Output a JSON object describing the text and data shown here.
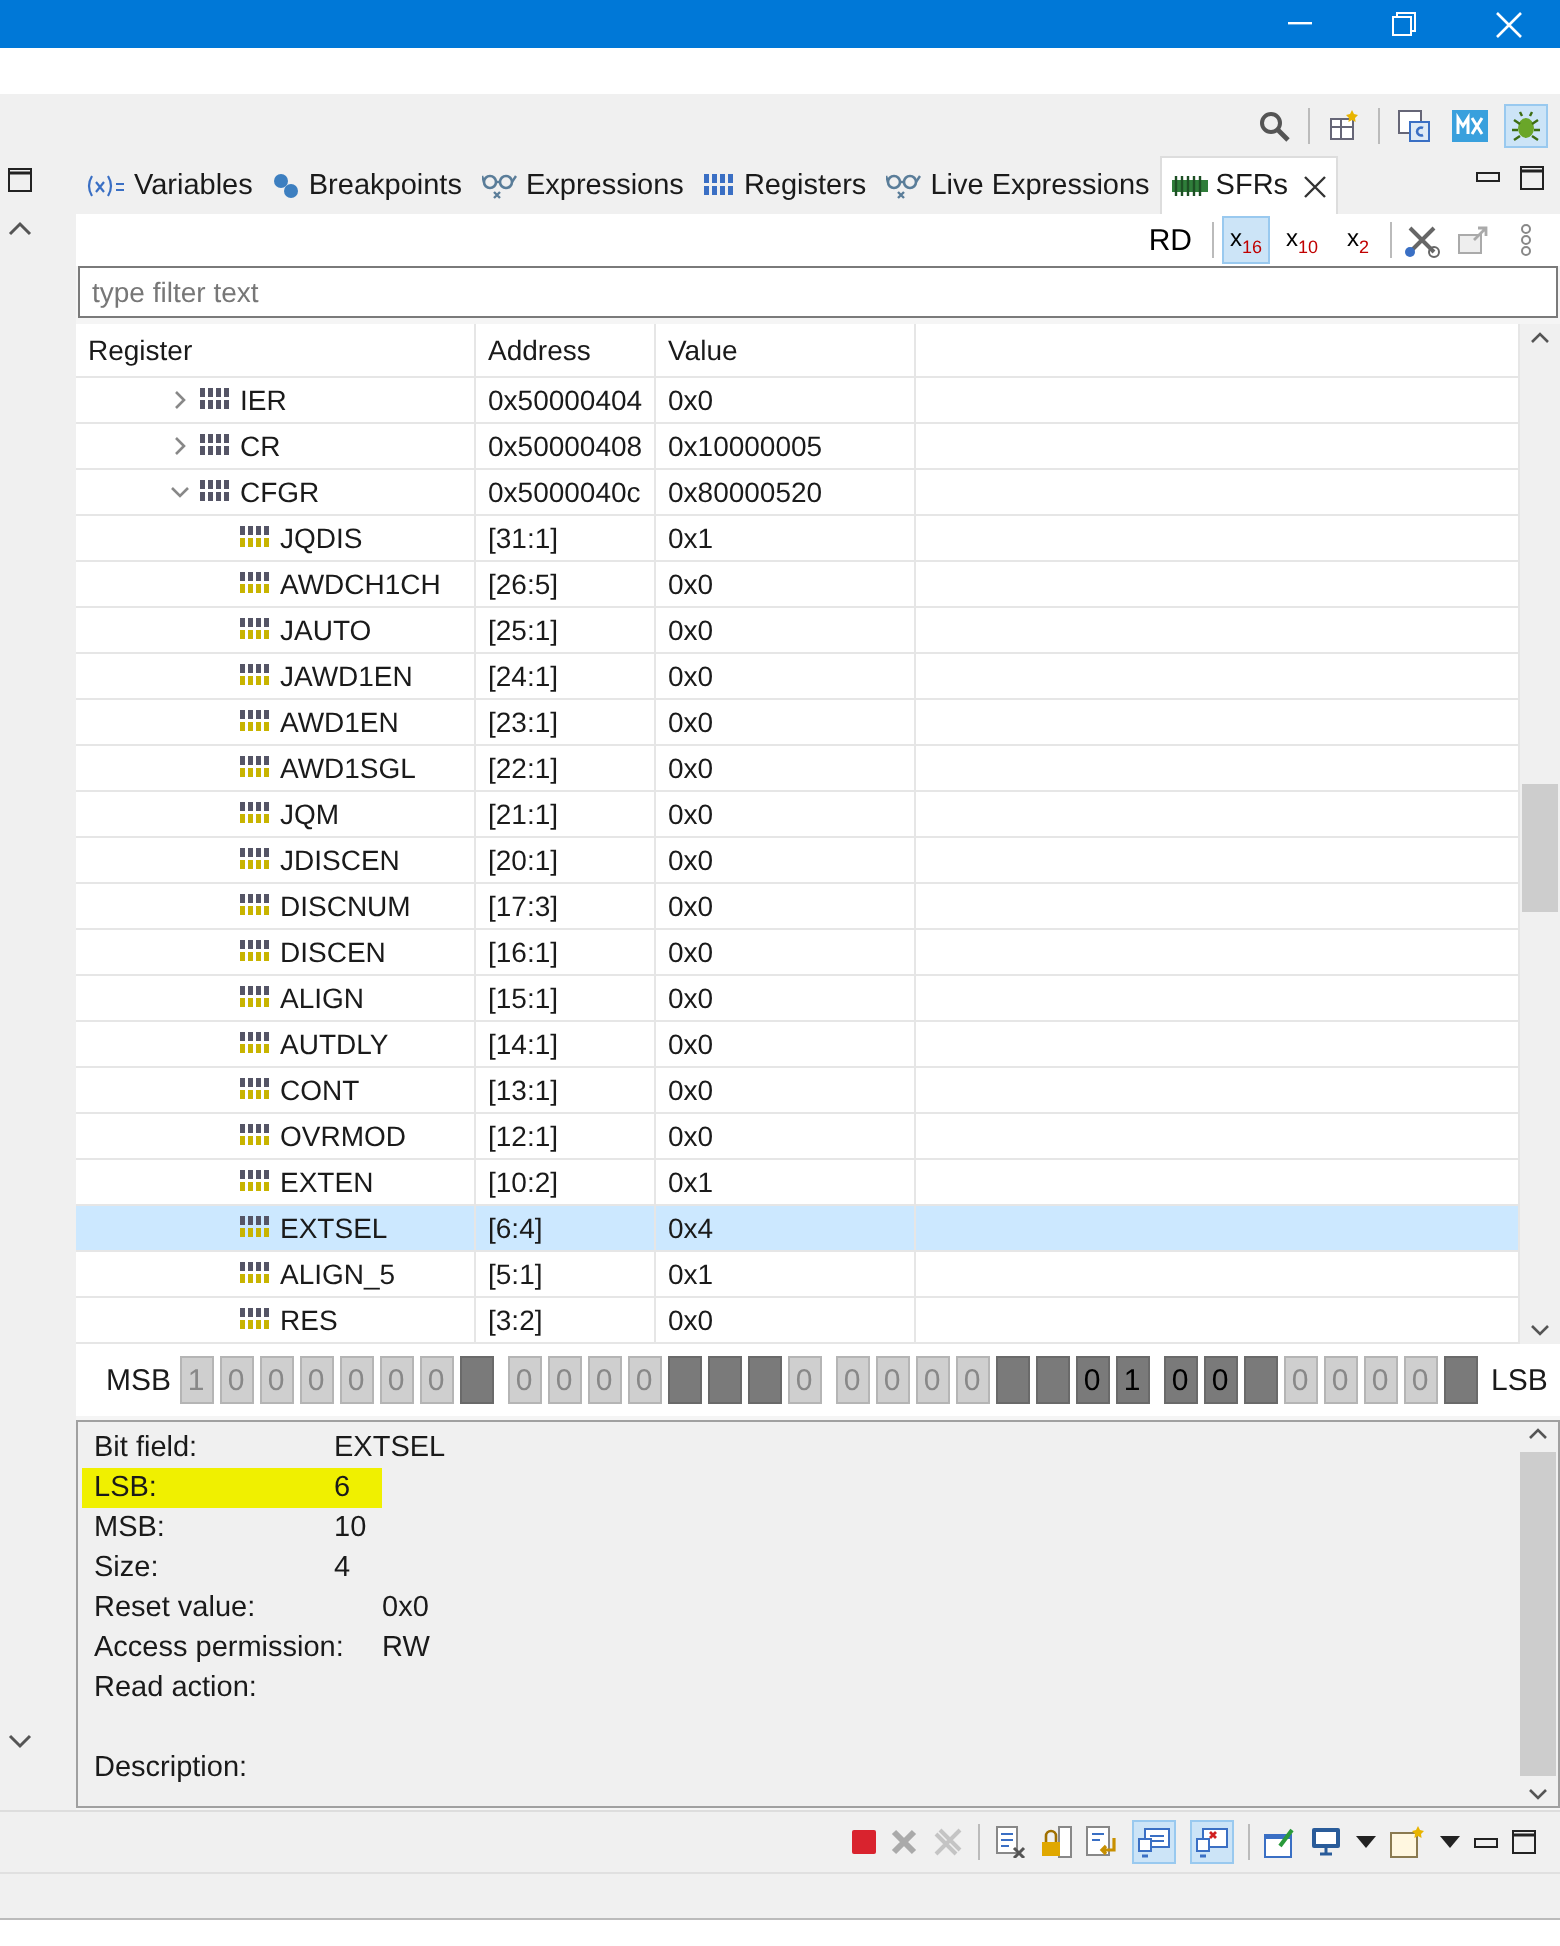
{
  "tabs": [
    {
      "label": "Variables",
      "kind": "variables",
      "selected": false
    },
    {
      "label": "Breakpoints",
      "kind": "breakpoints",
      "selected": false
    },
    {
      "label": "Expressions",
      "kind": "expressions",
      "selected": false
    },
    {
      "label": "Registers",
      "kind": "registers",
      "selected": false
    },
    {
      "label": "Live Expressions",
      "kind": "expressions",
      "selected": false
    },
    {
      "label": "SFRs",
      "kind": "sfrs",
      "selected": true
    }
  ],
  "view_toolbar": {
    "read_button": "RD",
    "formats": [
      {
        "label": "x$_{16}$",
        "selected": true
      },
      {
        "label": "x$_{10}$",
        "selected": false
      },
      {
        "label": "x$_{2}$",
        "selected": false
      }
    ]
  },
  "filter": {
    "placeholder": "type filter text"
  },
  "table": {
    "columns": [
      "Register",
      "Address",
      "Value"
    ],
    "rows": [
      {
        "name": "IER",
        "address": "0x50000404",
        "value": "0x0",
        "expanded": false,
        "selected": false
      },
      {
        "name": "CR",
        "address": "0x50000408",
        "value": "0x10000005",
        "expanded": false,
        "selected": false
      },
      {
        "name": "CFGR",
        "address": "0x5000040c",
        "value": "0x80000520",
        "expanded": true,
        "selected": false,
        "children": [
          {
            "name": "JQDIS",
            "address": "[31:1]",
            "value": "0x1",
            "selected": false
          },
          {
            "name": "AWDCH1CH",
            "address": "[26:5]",
            "value": "0x0",
            "selected": false
          },
          {
            "name": "JAUTO",
            "address": "[25:1]",
            "value": "0x0",
            "selected": false
          },
          {
            "name": "JAWD1EN",
            "address": "[24:1]",
            "value": "0x0",
            "selected": false
          },
          {
            "name": "AWD1EN",
            "address": "[23:1]",
            "value": "0x0",
            "selected": false
          },
          {
            "name": "AWD1SGL",
            "address": "[22:1]",
            "value": "0x0",
            "selected": false
          },
          {
            "name": "JQM",
            "address": "[21:1]",
            "value": "0x0",
            "selected": false
          },
          {
            "name": "JDISCEN",
            "address": "[20:1]",
            "value": "0x0",
            "selected": false
          },
          {
            "name": "DISCNUM",
            "address": "[17:3]",
            "value": "0x0",
            "selected": false
          },
          {
            "name": "DISCEN",
            "address": "[16:1]",
            "value": "0x0",
            "selected": false
          },
          {
            "name": "ALIGN",
            "address": "[15:1]",
            "value": "0x0",
            "selected": false
          },
          {
            "name": "AUTDLY",
            "address": "[14:1]",
            "value": "0x0",
            "selected": false
          },
          {
            "name": "CONT",
            "address": "[13:1]",
            "value": "0x0",
            "selected": false
          },
          {
            "name": "OVRMOD",
            "address": "[12:1]",
            "value": "0x0",
            "selected": false
          },
          {
            "name": "EXTEN",
            "address": "[10:2]",
            "value": "0x1",
            "selected": false
          },
          {
            "name": "EXTSEL",
            "address": "[6:4]",
            "value": "0x4",
            "selected": true
          },
          {
            "name": "ALIGN_5",
            "address": "[5:1]",
            "value": "0x1",
            "selected": false
          },
          {
            "name": "RES",
            "address": "[3:2]",
            "value": "0x0",
            "selected": false
          }
        ]
      }
    ]
  },
  "bit_view": {
    "msb_label": "MSB",
    "lsb_label": "LSB",
    "bits": [
      {
        "kind": "bit",
        "text": "1"
      },
      {
        "kind": "bit",
        "text": "0"
      },
      {
        "kind": "bit",
        "text": "0"
      },
      {
        "kind": "bit",
        "text": "0"
      },
      {
        "kind": "bit",
        "text": "0"
      },
      {
        "kind": "bit",
        "text": "0"
      },
      {
        "kind": "bit",
        "text": "0"
      },
      {
        "kind": "reserved"
      },
      {
        "kind": "bit",
        "text": "0"
      },
      {
        "kind": "bit",
        "text": "0"
      },
      {
        "kind": "bit",
        "text": "0"
      },
      {
        "kind": "bit",
        "text": "0"
      },
      {
        "kind": "reserved"
      },
      {
        "kind": "reserved"
      },
      {
        "kind": "reserved"
      },
      {
        "kind": "bit",
        "text": "0"
      },
      {
        "kind": "bit",
        "text": "0"
      },
      {
        "kind": "bit",
        "text": "0"
      },
      {
        "kind": "bit",
        "text": "0"
      },
      {
        "kind": "bit",
        "text": "0"
      },
      {
        "kind": "reserved"
      },
      {
        "kind": "reserved"
      },
      {
        "kind": "selected",
        "text": "0"
      },
      {
        "kind": "selected",
        "text": "1"
      },
      {
        "kind": "selected",
        "text": "0"
      },
      {
        "kind": "selected",
        "text": "0"
      },
      {
        "kind": "reserved"
      },
      {
        "kind": "bit",
        "text": "0"
      },
      {
        "kind": "bit",
        "text": "0"
      },
      {
        "kind": "bit",
        "text": "0"
      },
      {
        "kind": "bit",
        "text": "0"
      },
      {
        "kind": "reserved"
      }
    ]
  },
  "details": [
    {
      "label": "Bit field:",
      "value": "EXTSEL",
      "kind": "short",
      "highlighted": false
    },
    {
      "label": "LSB:",
      "value": "6",
      "kind": "short",
      "highlighted": true
    },
    {
      "label": "MSB:",
      "value": "10",
      "kind": "short",
      "highlighted": false
    },
    {
      "label": "Size:",
      "value": "4",
      "kind": "short",
      "highlighted": false
    },
    {
      "label": "Reset value:",
      "value": "0x0",
      "kind": "long",
      "highlighted": false
    },
    {
      "label": "Access permission:",
      "value": "RW",
      "kind": "long",
      "highlighted": false
    },
    {
      "label": "Read action:",
      "kind": "long",
      "highlighted": false
    },
    {
      "label": "Description:",
      "kind": "section",
      "highlighted": false
    }
  ]
}
